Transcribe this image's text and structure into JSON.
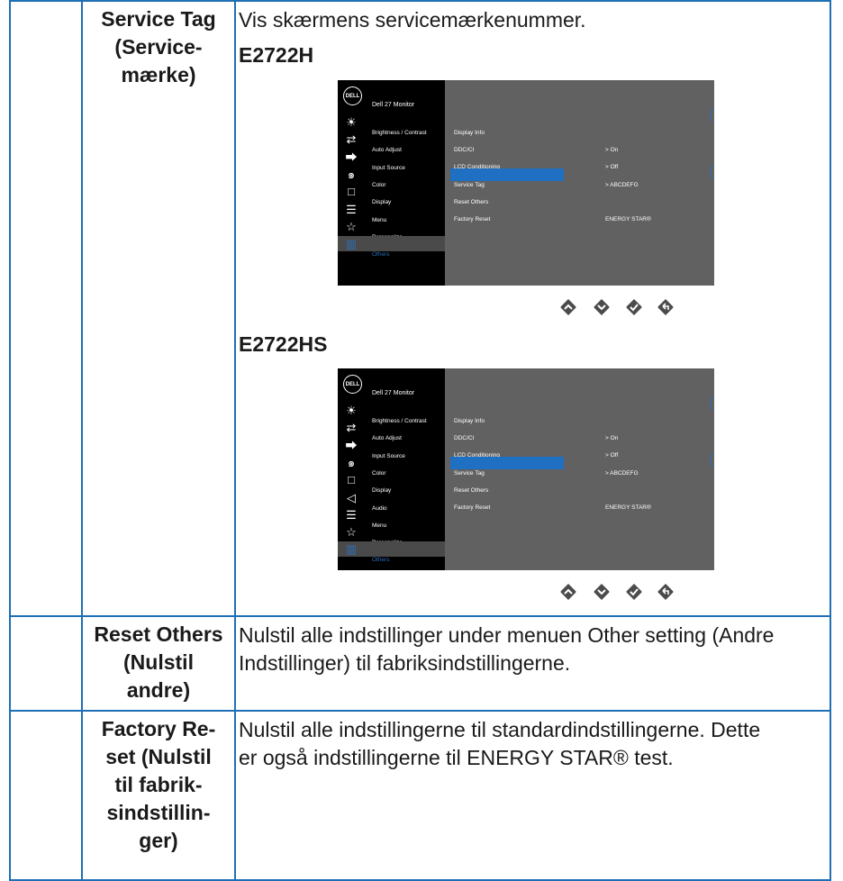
{
  "rows": [
    {
      "label": "Service Tag (Servicemærke)",
      "label_lines": [
        "Service Tag",
        "(Service-",
        "mærke)"
      ],
      "description": "Vis skærmens servicemærkenummer.",
      "models": [
        {
          "name": "E2722H",
          "osd": {
            "monitor_title": "Dell 27 Monitor",
            "logo": "DELL",
            "menu_items": [
              {
                "icon": "brightness-icon",
                "label": "Brightness / Contrast"
              },
              {
                "icon": "auto-adjust-icon",
                "label": "Auto Adjust"
              },
              {
                "icon": "input-source-icon",
                "label": "Input Source"
              },
              {
                "icon": "color-icon",
                "label": "Color"
              },
              {
                "icon": "display-icon",
                "label": "Display"
              },
              {
                "icon": "menu-icon",
                "label": "Menu"
              },
              {
                "icon": "personalize-icon",
                "label": "Personalize"
              },
              {
                "icon": "others-icon",
                "label": "Others",
                "selected": true
              }
            ],
            "submenu_items": [
              {
                "label": "Display Info"
              },
              {
                "label": "DDC/CI",
                "value": ">   On"
              },
              {
                "label": "LCD Conditioning",
                "value": ">   Off"
              },
              {
                "label": "Service Tag",
                "value": ">   ABCDEFG",
                "selected": true
              },
              {
                "label": "Reset Others"
              },
              {
                "label": "Factory Reset",
                "value": "ENERGY STAR®"
              }
            ]
          }
        },
        {
          "name": "E2722HS",
          "osd": {
            "monitor_title": "Dell 27 Monitor",
            "logo": "DELL",
            "menu_items": [
              {
                "icon": "brightness-icon",
                "label": "Brightness / Contrast"
              },
              {
                "icon": "auto-adjust-icon",
                "label": "Auto Adjust"
              },
              {
                "icon": "input-source-icon",
                "label": "Input Source"
              },
              {
                "icon": "color-icon",
                "label": "Color"
              },
              {
                "icon": "display-icon",
                "label": "Display"
              },
              {
                "icon": "audio-icon",
                "label": "Audio"
              },
              {
                "icon": "menu-icon",
                "label": "Menu"
              },
              {
                "icon": "personalize-icon",
                "label": "Personalize"
              },
              {
                "icon": "others-icon",
                "label": "Others",
                "selected": true
              }
            ],
            "submenu_items": [
              {
                "label": "Display Info"
              },
              {
                "label": "DDC/CI",
                "value": ">   On"
              },
              {
                "label": "LCD Conditioning",
                "value": ">   Off"
              },
              {
                "label": "Service Tag",
                "value": ">   ABCDEFG",
                "selected": true
              },
              {
                "label": "Reset Others"
              },
              {
                "label": "Factory Reset",
                "value": "ENERGY STAR®"
              }
            ]
          }
        }
      ],
      "buttons": [
        "up-button-icon",
        "down-button-icon",
        "ok-button-icon",
        "back-button-icon"
      ]
    },
    {
      "label_lines": [
        "Reset Others",
        "(Nulstil",
        "andre)"
      ],
      "description_lines": [
        "Nulstil alle indstillinger under menuen Other setting (Andre",
        "Indstillinger) til fabriksindstillingerne."
      ]
    },
    {
      "label_lines": [
        "Factory Re-",
        "set (Nulstil",
        "til fabrik-",
        "sindstillin-",
        "ger)"
      ],
      "description_lines": [
        "Nulstil alle indstillingerne til standardindstillingerne. Dette",
        "er også indstillingerne til ENERGY STAR® test."
      ]
    }
  ],
  "colors": {
    "border": "#1f6fb4",
    "osd_highlight": "#1f6fc2",
    "button": "#4b4b4b"
  }
}
